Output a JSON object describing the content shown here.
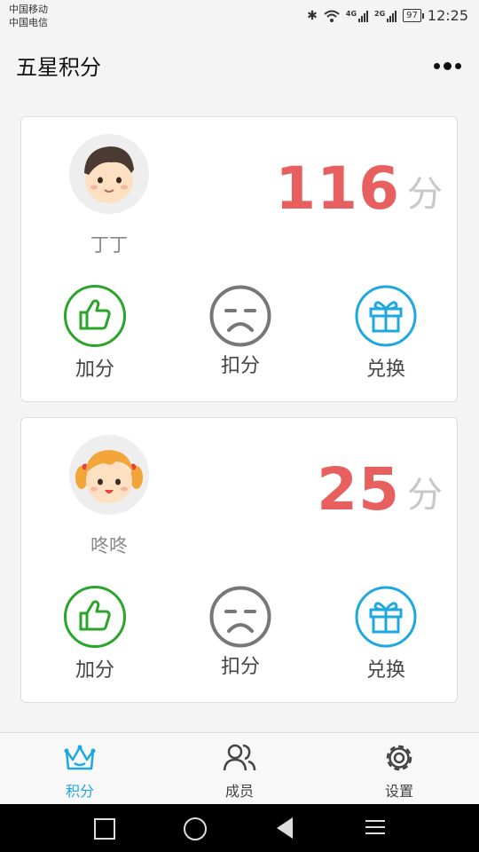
{
  "status_bar": {
    "carrier1": "中国移动",
    "carrier2": "中国电信",
    "net1": "4G",
    "net2": "2G",
    "battery": "97",
    "time": "12:25"
  },
  "header": {
    "title": "五星积分",
    "menu_icon": "more-dots-icon"
  },
  "members": [
    {
      "name": "丁丁",
      "score": "116",
      "unit": "分",
      "avatar": "boy-avatar",
      "actions": {
        "add": "加分",
        "deduct": "扣分",
        "redeem": "兑换"
      }
    },
    {
      "name": "咚咚",
      "score": "25",
      "unit": "分",
      "avatar": "girl-avatar",
      "actions": {
        "add": "加分",
        "deduct": "扣分",
        "redeem": "兑换"
      }
    }
  ],
  "colors": {
    "score": "#e85f5f",
    "add": "#2aa52a",
    "deduct": "#777777",
    "redeem": "#1ea8e0",
    "tab_active": "#1ea8e0"
  },
  "tabs": [
    {
      "label": "积分",
      "icon": "crown-icon",
      "active": true
    },
    {
      "label": "成员",
      "icon": "members-icon",
      "active": false
    },
    {
      "label": "设置",
      "icon": "gear-icon",
      "active": false
    }
  ]
}
